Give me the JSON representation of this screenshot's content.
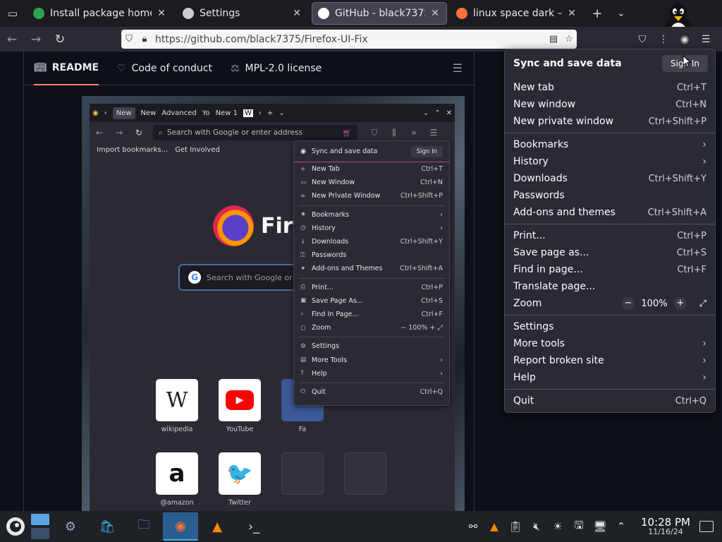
{
  "browser": {
    "tabs": [
      {
        "label": "Install package home",
        "favicon_color": "#2ea44f",
        "selected": false
      },
      {
        "label": "Settings",
        "favicon_color": "#cccccc",
        "selected": false
      },
      {
        "label": "GitHub - black7375/F",
        "favicon_color": "#ffffff",
        "selected": true
      },
      {
        "label": "linux space dark – Ge",
        "favicon_color": "#ff7139",
        "selected": false
      }
    ],
    "url": "https://github.com/black7375/Firefox-UI-Fix"
  },
  "github": {
    "tabs": [
      {
        "label": "README",
        "icon": "book-icon"
      },
      {
        "label": "Code of conduct",
        "icon": "heart-icon"
      },
      {
        "label": "MPL-2.0 license",
        "icon": "scale-icon"
      }
    ]
  },
  "embedded": {
    "tabs": [
      "New",
      "New",
      "Advanced",
      "Yo",
      "New 1"
    ],
    "search_placeholder": "Search with Google or enter address",
    "bookmarks": [
      "Import bookmarks...",
      "Get Involved"
    ],
    "logo_text": "Firef",
    "page_search": "Search with Google or e",
    "tiles": [
      {
        "label": "wikipedia",
        "glyph": "W"
      },
      {
        "label": "YouTube",
        "glyph": "▶"
      },
      {
        "label": "Fa",
        "glyph": ""
      },
      {
        "label": "@amazon",
        "glyph": "a"
      },
      {
        "label": "Twitter",
        "glyph": "🐦"
      }
    ],
    "menu": {
      "sync_label": "Sync and save data",
      "sign_in": "Sign In",
      "items": [
        {
          "label": "New Tab",
          "shortcut": "Ctrl+T",
          "icon": "+"
        },
        {
          "label": "New Window",
          "shortcut": "Ctrl+N",
          "icon": "▭"
        },
        {
          "label": "New Private Window",
          "shortcut": "Ctrl+Shift+P",
          "icon": "∞"
        },
        {
          "sep": true
        },
        {
          "label": "Bookmarks",
          "shortcut": "›",
          "icon": "★"
        },
        {
          "label": "History",
          "shortcut": "›",
          "icon": "◷"
        },
        {
          "label": "Downloads",
          "shortcut": "Ctrl+Shift+Y",
          "icon": "↓"
        },
        {
          "label": "Passwords",
          "shortcut": "",
          "icon": "⚿"
        },
        {
          "label": "Add-ons and Themes",
          "shortcut": "Ctrl+Shift+A",
          "icon": "✦"
        },
        {
          "sep": true
        },
        {
          "label": "Print...",
          "shortcut": "Ctrl+P",
          "icon": "⎙"
        },
        {
          "label": "Save Page As...",
          "shortcut": "Ctrl+S",
          "icon": "▣"
        },
        {
          "label": "Find In Page...",
          "shortcut": "Ctrl+F",
          "icon": "⌕"
        },
        {
          "label": "Zoom",
          "shortcut": "−   100%   +  ⤢",
          "icon": "◻"
        },
        {
          "sep": true
        },
        {
          "label": "Settings",
          "shortcut": "",
          "icon": "⚙"
        },
        {
          "label": "More Tools",
          "shortcut": "›",
          "icon": "▤"
        },
        {
          "label": "Help",
          "shortcut": "›",
          "icon": "?"
        },
        {
          "sep": true
        },
        {
          "label": "Quit",
          "shortcut": "Ctrl+Q",
          "icon": "⏻"
        }
      ]
    }
  },
  "app_menu": {
    "sync_label": "Sync and save data",
    "sign_in": "Sign In",
    "groups": [
      [
        {
          "label": "New tab",
          "shortcut": "Ctrl+T"
        },
        {
          "label": "New window",
          "shortcut": "Ctrl+N"
        },
        {
          "label": "New private window",
          "shortcut": "Ctrl+Shift+P"
        }
      ],
      [
        {
          "label": "Bookmarks",
          "submenu": true
        },
        {
          "label": "History",
          "submenu": true
        },
        {
          "label": "Downloads",
          "shortcut": "Ctrl+Shift+Y"
        },
        {
          "label": "Passwords",
          "shortcut": ""
        },
        {
          "label": "Add-ons and themes",
          "shortcut": "Ctrl+Shift+A"
        }
      ],
      [
        {
          "label": "Print...",
          "shortcut": "Ctrl+P"
        },
        {
          "label": "Save page as...",
          "shortcut": "Ctrl+S"
        },
        {
          "label": "Find in page...",
          "shortcut": "Ctrl+F"
        },
        {
          "label": "Translate page...",
          "shortcut": ""
        },
        {
          "label": "Zoom",
          "zoom": true
        }
      ],
      [
        {
          "label": "Settings",
          "shortcut": ""
        },
        {
          "label": "More tools",
          "submenu": true
        },
        {
          "label": "Report broken site",
          "submenu": true
        },
        {
          "label": "Help",
          "submenu": true
        }
      ],
      [
        {
          "label": "Quit",
          "shortcut": "Ctrl+Q"
        }
      ]
    ],
    "zoom": {
      "minus": "−",
      "value": "100%",
      "plus": "+"
    }
  },
  "taskbar": {
    "apps": [
      {
        "name": "system-settings",
        "glyph": "⚙",
        "color": "#9ab"
      },
      {
        "name": "discover-store",
        "glyph": "🛍",
        "color": "#3daee9"
      },
      {
        "name": "file-manager",
        "glyph": "🗀",
        "color": "#5da4e3"
      },
      {
        "name": "firefox",
        "glyph": "◉",
        "color": "#ff7139",
        "active": true
      },
      {
        "name": "vlc",
        "glyph": "▲",
        "color": "#ff8800"
      },
      {
        "name": "konsole",
        "glyph": "›_",
        "color": "#ddd"
      }
    ],
    "clock_time": "10:28 PM",
    "clock_date": "11/16/24"
  }
}
